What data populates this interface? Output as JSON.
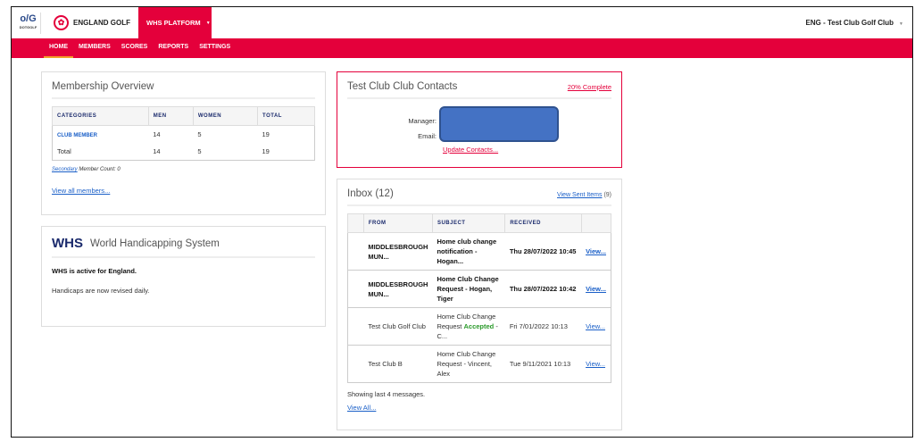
{
  "header": {
    "dotgolf_logo": "DOTGOLF",
    "brand": "ENGLAND GOLF",
    "platform": "WHS PLATFORM",
    "club": "ENG - Test Club Golf Club"
  },
  "nav": [
    "HOME",
    "MEMBERS",
    "SCORES",
    "REPORTS",
    "SETTINGS"
  ],
  "membership": {
    "title": "Membership Overview",
    "headers": [
      "CATEGORIES",
      "MEN",
      "WOMEN",
      "TOTAL"
    ],
    "rows": [
      [
        "CLUB MEMBER",
        "14",
        "5",
        "19"
      ],
      [
        "Total",
        "14",
        "5",
        "19"
      ]
    ],
    "secondary_link": "Secondary",
    "secondary_text": "Member Count: 0",
    "view_all": "View all members..."
  },
  "whs": {
    "logo": "WHS",
    "title": "World Handicapping System",
    "active": "WHS is active for England.",
    "revised": "Handicaps are now revised daily."
  },
  "contacts": {
    "title": "Test Club Club Contacts",
    "complete": "20% Complete",
    "manager_label": "Manager:",
    "email_label": "Email:",
    "update": "Update Contacts..."
  },
  "inbox": {
    "title": "Inbox (12)",
    "sent_link": "View Sent Items",
    "sent_count": "(9)",
    "headers": [
      "",
      "FROM",
      "SUBJECT",
      "RECEIVED",
      ""
    ],
    "rows": [
      {
        "from": "MIDDLESBROUGH MUN...",
        "subject": "Home club change notification - Hogan...",
        "received": "Thu 28/07/2022 10:45",
        "view": "View..."
      },
      {
        "from": "MIDDLESBROUGH MUN...",
        "subject": "Home Club Change Request - Hogan, Tiger",
        "received": "Thu 28/07/2022 10:42",
        "view": "View..."
      },
      {
        "from": "Test Club Golf Club",
        "subject_pre": "Home Club Change Request",
        "subject_accent": "Accepted",
        "subject_post": "- C...",
        "received": "Fri 7/01/2022 10:13",
        "view": "View..."
      },
      {
        "from": "Test Club B",
        "subject": "Home Club Change Request - Vincent, Alex",
        "received": "Tue 9/11/2021 10:13",
        "view": "View..."
      }
    ],
    "showing": "Showing last 4 messages.",
    "view_all": "View All..."
  },
  "colors": {
    "brand_red": "#e4003b",
    "accent_green": "#2a9a2a",
    "redaction_blue": "#4472c4"
  }
}
